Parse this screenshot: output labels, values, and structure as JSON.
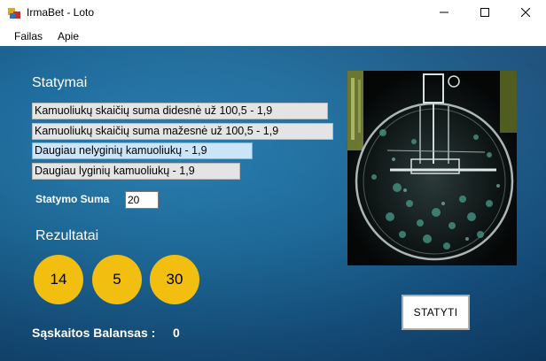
{
  "window": {
    "title": "IrmaBet - Loto",
    "icon": "app-icon",
    "controls": [
      "minimize-icon",
      "maximize-icon",
      "close-icon"
    ]
  },
  "menu": {
    "items": [
      "Failas",
      "Apie"
    ]
  },
  "bets": {
    "title": "Statymai",
    "options": [
      "Kamuoliukų skaičių suma didesnė už 100,5 - 1,9",
      "Kamuoliukų skaičių suma mažesnė už 100,5 - 1,9",
      "Daugiau nelyginių kamuoliukų - 1,9",
      "Daugiau lyginių kamuoliukų - 1,9"
    ],
    "selected_index": 2,
    "selected_color": "#cce4f7"
  },
  "stake": {
    "label": "Statymo Suma",
    "value": "20"
  },
  "results": {
    "title": "Rezultatai",
    "balls": [
      "14",
      "5",
      "30"
    ],
    "ball_color": "#f2bf10"
  },
  "balance": {
    "label": "Sąskaitos Balansas :",
    "value": "0"
  },
  "actions": {
    "bet_button": "STATYTI"
  },
  "image": {
    "icon": "lotto-drum-image"
  },
  "colors": {
    "background": "#1e6a9a",
    "text": "#ffffff"
  }
}
